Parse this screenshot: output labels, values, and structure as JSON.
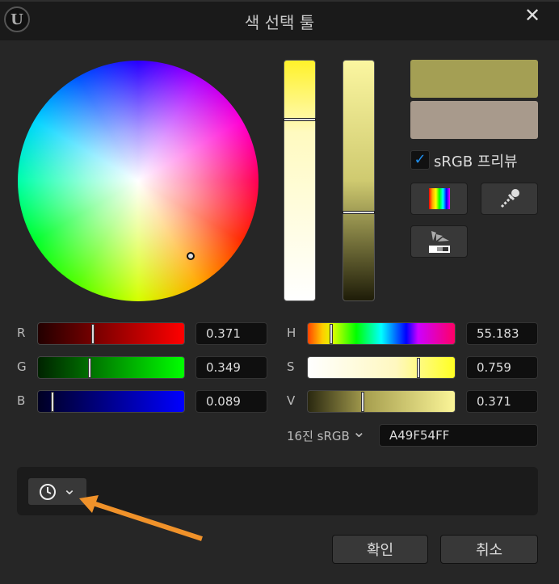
{
  "window": {
    "title": "색 선택 툴",
    "logo": "U",
    "close_icon": "close-icon"
  },
  "preview": {
    "new_color": "#a49f54",
    "old_color": "#a89a8c",
    "srgb_checked": true,
    "srgb_label": "sRGB 프리뷰",
    "check_glyph": "✓"
  },
  "rgb": [
    {
      "label": "R",
      "value": "0.371",
      "fraction": 0.371
    },
    {
      "label": "G",
      "value": "0.349",
      "fraction": 0.349
    },
    {
      "label": "B",
      "value": "0.089",
      "fraction": 0.089
    }
  ],
  "hsv": [
    {
      "label": "H",
      "value": "55.183",
      "fraction": 0.153
    },
    {
      "label": "S",
      "value": "0.759",
      "fraction": 0.759
    },
    {
      "label": "V",
      "value": "0.371",
      "fraction": 0.371
    }
  ],
  "hex": {
    "label": "16진 sRGB",
    "value": "A49F54FF",
    "chevron": "⌄"
  },
  "vsliders": {
    "saturation": 0.24,
    "value": 0.63
  },
  "history": {
    "chevron": "⌄"
  },
  "buttons": {
    "ok": "확인",
    "cancel": "취소"
  }
}
